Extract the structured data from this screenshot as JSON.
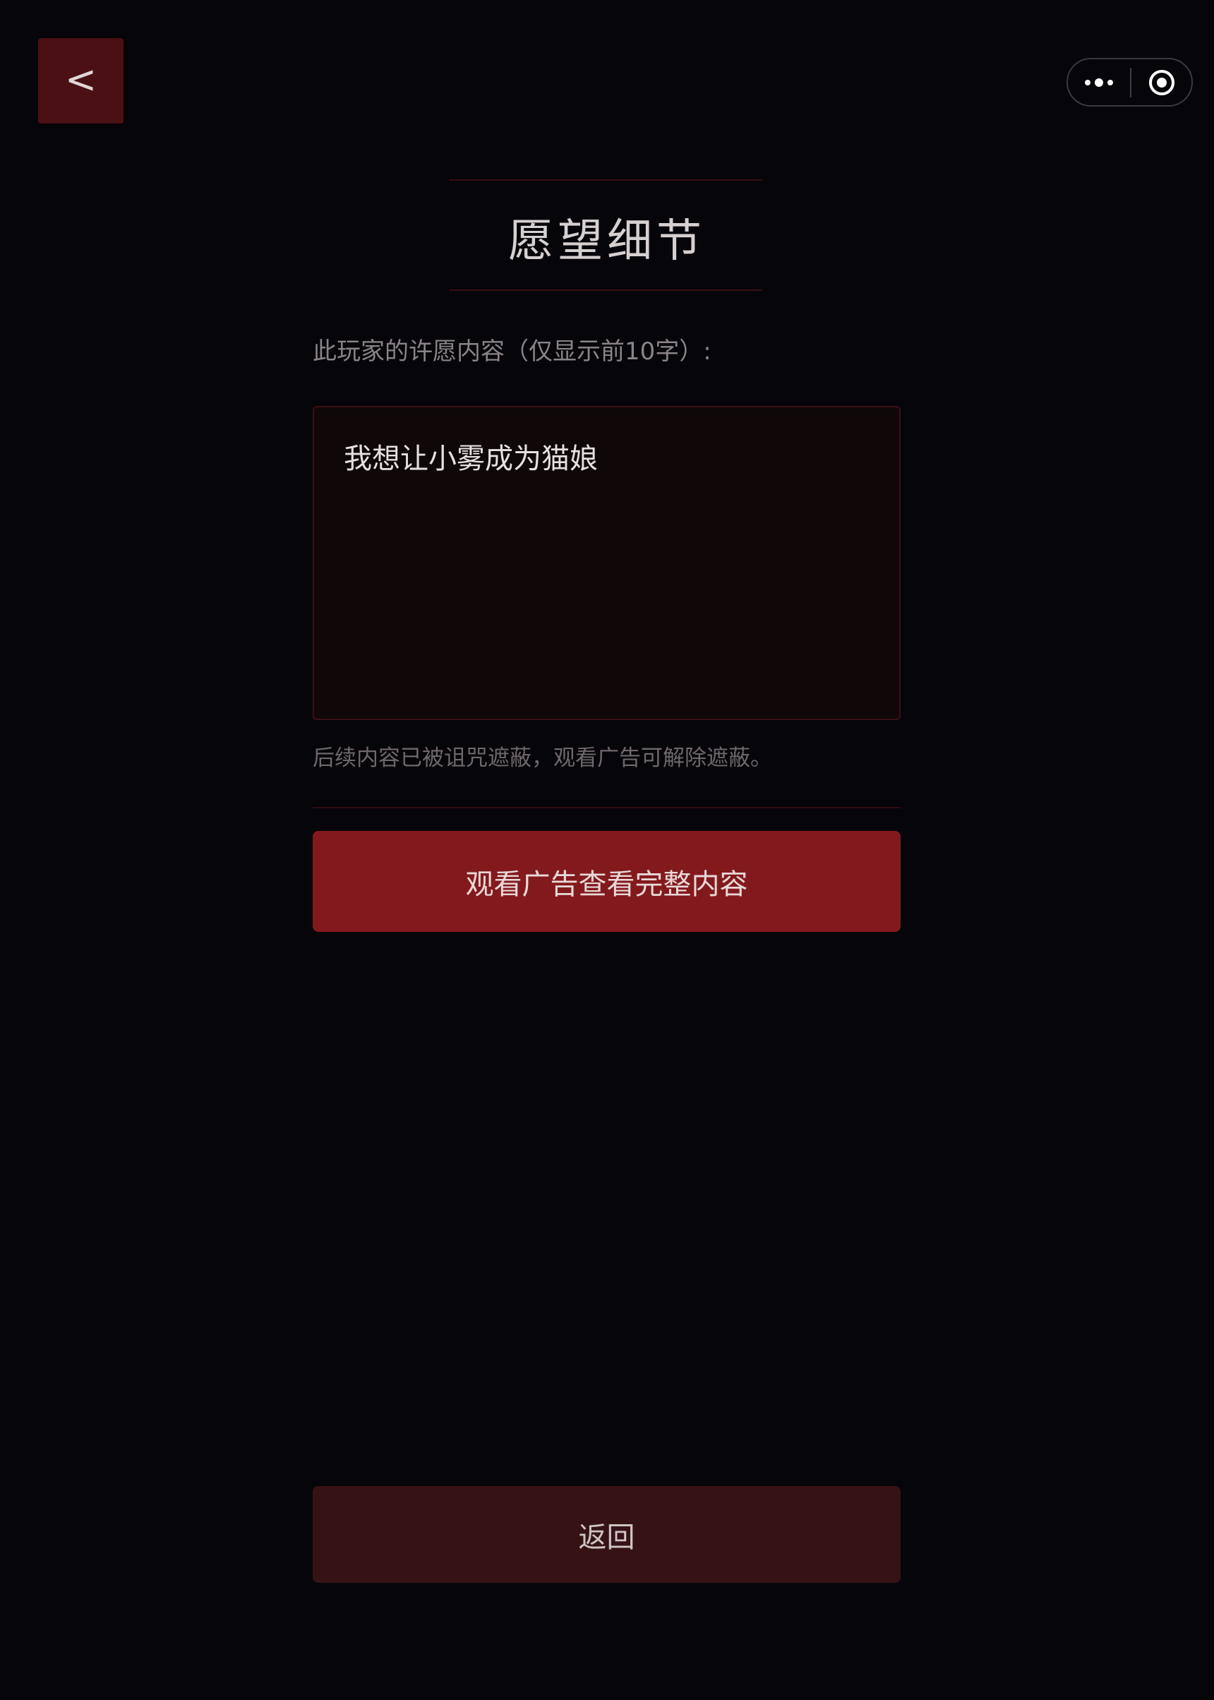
{
  "nav": {
    "back_glyph": "<"
  },
  "capsule": {
    "more_icon": "more-dots-icon",
    "close_icon": "target-circle-icon"
  },
  "page": {
    "title": "愿望细节",
    "content_label": "此玩家的许愿内容（仅显示前10字）:",
    "wish_text": "我想让小雾成为猫娘",
    "hint": "后续内容已被诅咒遮蔽，观看广告可解除遮蔽。",
    "watch_ad_button": "观看广告查看完整内容",
    "return_button": "返回"
  },
  "colors": {
    "background": "#06050a",
    "back_button": "#4a1014",
    "primary_button": "#821a1d",
    "secondary_button": "#351315",
    "wish_box_bg": "#0f0708",
    "accent_line": "#3a0f13"
  }
}
